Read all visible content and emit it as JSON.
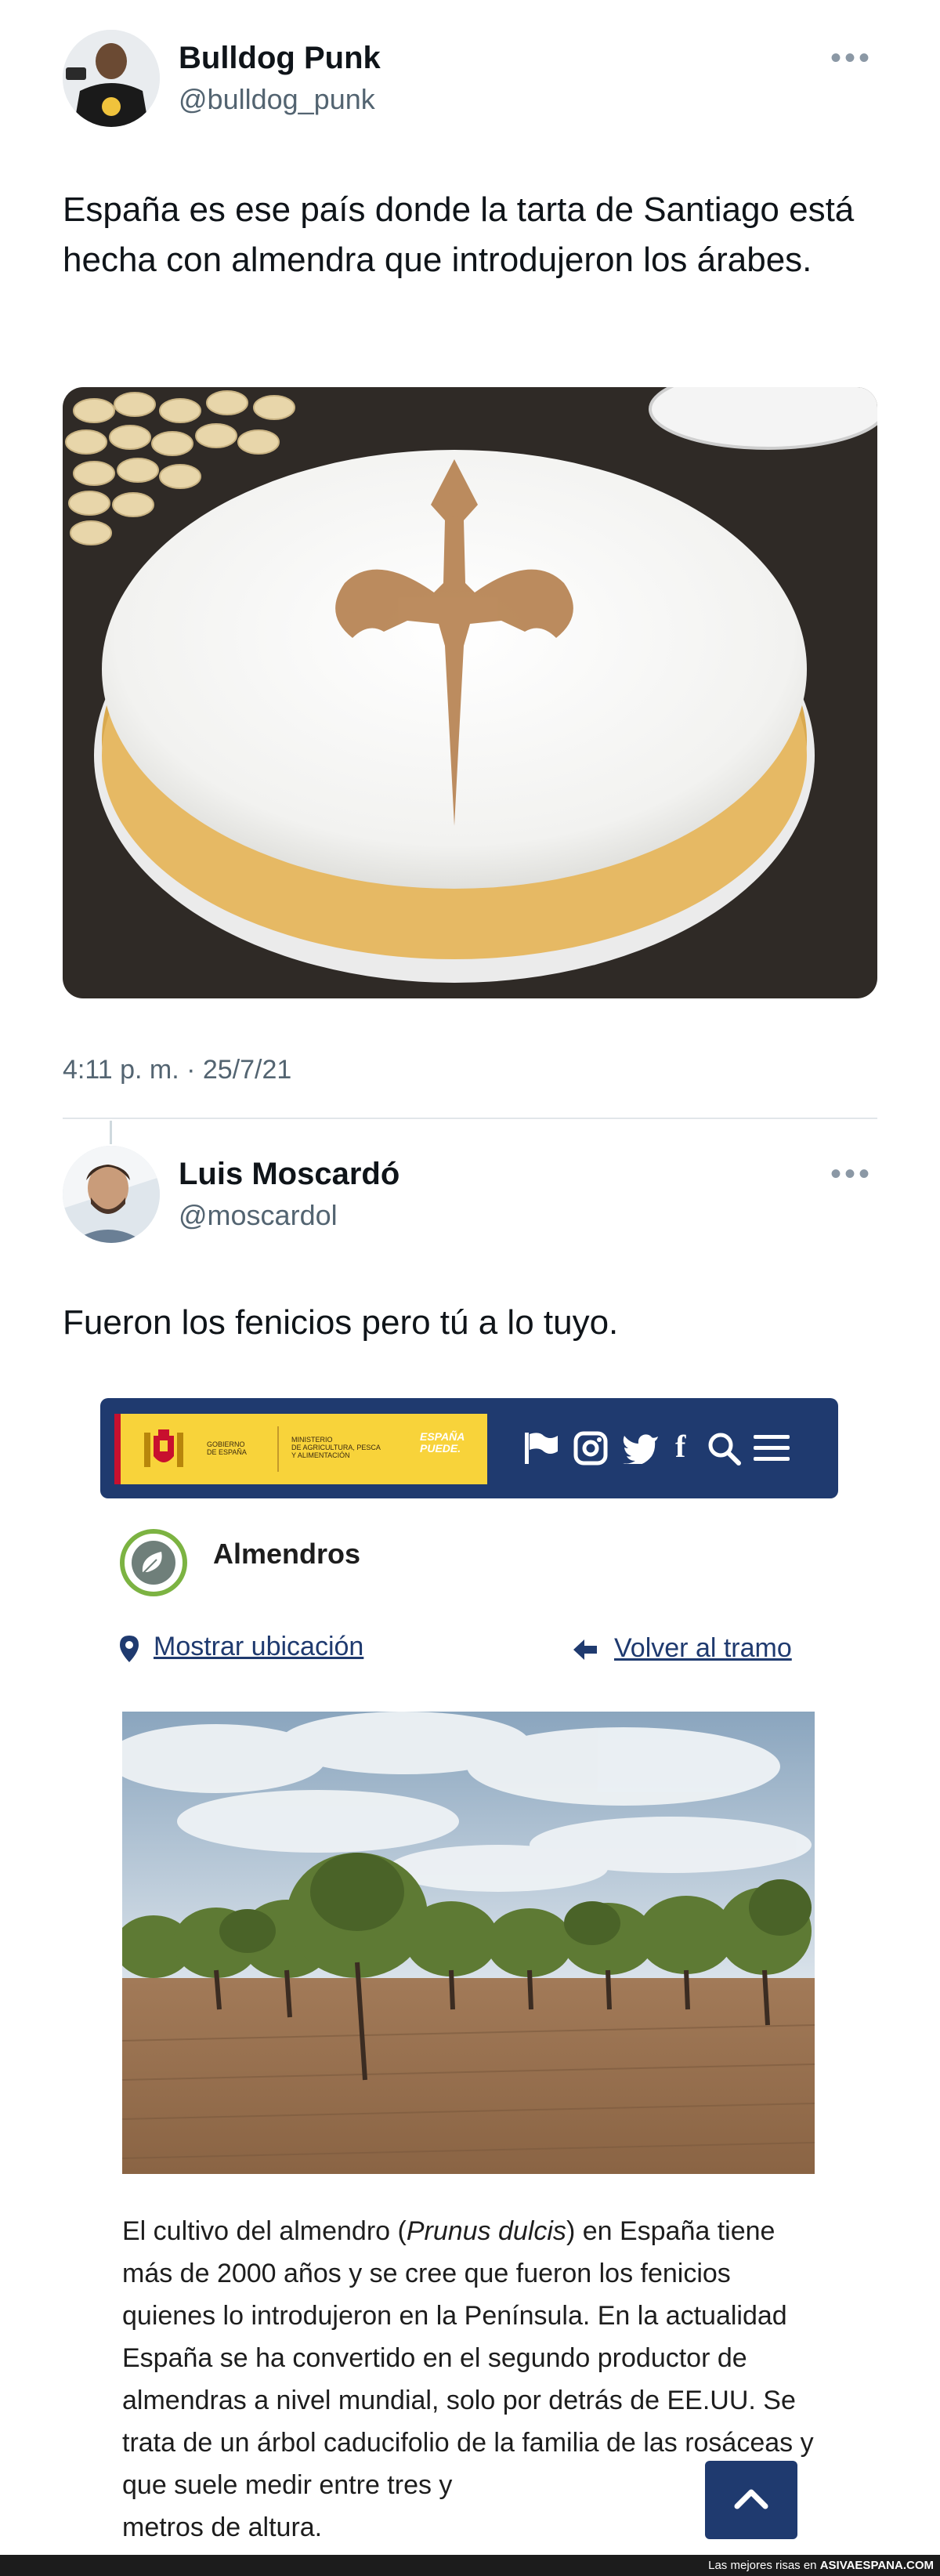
{
  "tweet1": {
    "name": "Bulldog Punk",
    "handle": "@bulldog_punk",
    "text": "España es ese país donde la tarta de Santiago está hecha con almendra que introdujeron los árabes.",
    "timestamp": "4:11 p. m. · 25/7/21",
    "more_icon": "more-horizontal-icon"
  },
  "tweet2": {
    "name": "Luis Moscardó",
    "handle": "@moscardol",
    "text": "Fueron los fenicios pero tú a lo tuyo.",
    "more_icon": "more-horizontal-icon"
  },
  "embed": {
    "header": {
      "gov_line1": "GOBIERNO",
      "gov_line2": "DE ESPAÑA",
      "ministry_line1": "MINISTERIO",
      "ministry_line2": "DE AGRICULTURA, PESCA",
      "ministry_line3": "Y ALIMENTACIÓN",
      "espana_line1": "ESPAÑA",
      "espana_line2": "PUEDE.",
      "icons": [
        "flag-icon",
        "instagram-icon",
        "twitter-icon",
        "facebook-icon",
        "search-icon",
        "menu-icon"
      ]
    },
    "title": "Almendros",
    "show_location": "Mostrar ubicación",
    "back_link": "Volver al tramo",
    "paragraph_part1": "El cultivo del almendro (",
    "species": "Prunus dulcis",
    "paragraph_part2": ") en España tiene más de 2000 años y se cree que fueron los fenicios quienes lo introdujeron en la Península. En la actualidad España se ha convertido en el segundo productor de almendras a nivel mundial, solo por detrás de EE.UU. Se trata de un árbol caducifolio de la familia de las rosáceas y que suele medir entre tres y",
    "paragraph_part3": "metros de altura."
  },
  "footer": {
    "text_prefix": "Las mejores risas en",
    "site": "ASIVAESPANA.COM"
  },
  "colors": {
    "navy": "#1f3a6f",
    "twitter_gray": "#536471",
    "footer_bg": "#1c1c1c"
  }
}
